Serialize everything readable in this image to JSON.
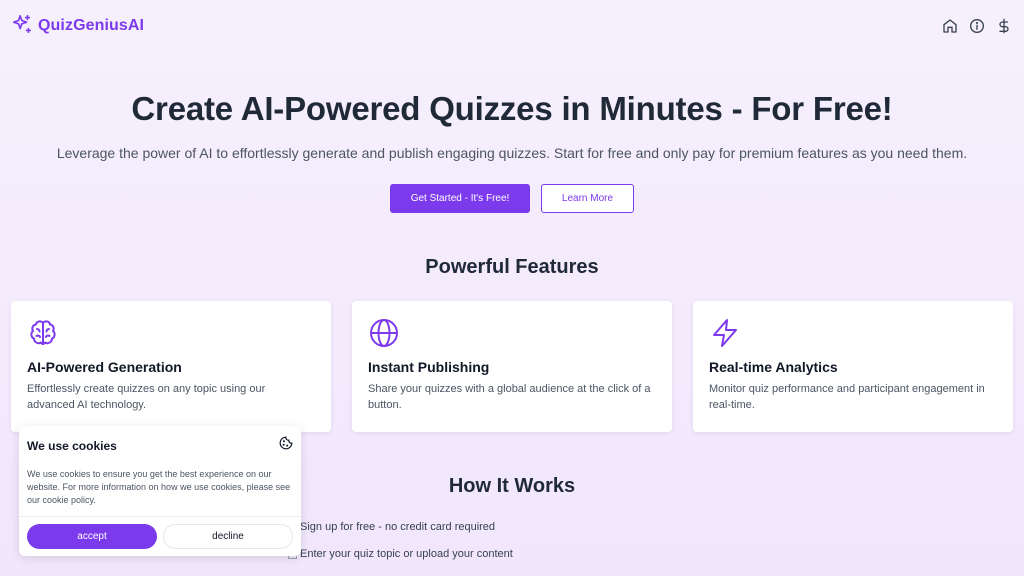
{
  "brand": {
    "name": "QuizGeniusAI",
    "icon": "sparkles-icon",
    "accent": "#7c3aed"
  },
  "nav": {
    "icons": [
      "home-icon",
      "info-icon",
      "dollar-icon"
    ]
  },
  "hero": {
    "title": "Create AI-Powered Quizzes in Minutes - For Free!",
    "subtitle": "Leverage the power of AI to effortlessly generate and publish engaging quizzes. Start for free and only pay for premium features as you need them.",
    "primary_button": "Get Started - It's Free!",
    "secondary_button": "Learn More"
  },
  "features": {
    "title": "Powerful Features",
    "items": [
      {
        "icon": "brain-icon",
        "title": "AI-Powered Generation",
        "desc": "Effortlessly create quizzes on any topic using our advanced AI technology."
      },
      {
        "icon": "globe-icon",
        "title": "Instant Publishing",
        "desc": "Share your quizzes with a global audience at the click of a button."
      },
      {
        "icon": "lightning-icon",
        "title": "Real-time Analytics",
        "desc": "Monitor quiz performance and participant engagement in real-time."
      }
    ]
  },
  "how_it_works": {
    "title": "How It Works",
    "steps": [
      "Sign up for free - no credit card required",
      "Enter your quiz topic or upload your content"
    ]
  },
  "cookie": {
    "title": "We use cookies",
    "icon": "cookie-icon",
    "text": "We use cookies to ensure you get the best experience on our website. For more information on how we use cookies, please see our cookie policy.",
    "accept": "accept",
    "decline": "decline"
  }
}
